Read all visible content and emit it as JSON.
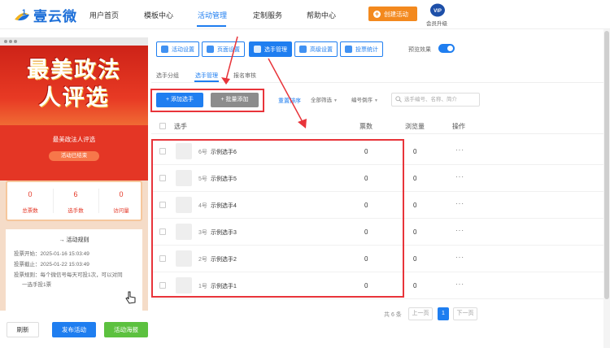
{
  "header": {
    "logo_text": "壹云微",
    "nav": [
      "用户首页",
      "模板中心",
      "活动管理",
      "定制服务",
      "帮助中心"
    ],
    "active_nav": "活动管理",
    "create_label": "创建活动",
    "vip_badge": "VIP",
    "vip_label": "会员升级"
  },
  "preview": {
    "hero_title_line1": "最美政法",
    "hero_title_line2": "人评选",
    "activity_title": "最美政法人评选",
    "status": "活动已结束",
    "stats": [
      {
        "value": "0",
        "label": "总票数"
      },
      {
        "value": "6",
        "label": "选手数"
      },
      {
        "value": "0",
        "label": "访问量"
      }
    ],
    "rules_title": "活动规则",
    "rules": [
      "投票开始：2025-01-16 15:03:49",
      "投票截止：2025-01-22 15:03:49",
      "投票规则：每个微信号每天可投1次，可以对同",
      "一选手投1票"
    ],
    "tabbar": [
      "介绍",
      "投票",
      "排行",
      "搜索"
    ]
  },
  "bottom_actions": {
    "refresh": "刷新",
    "publish": "发布活动",
    "poster": "活动海报"
  },
  "toolbar": {
    "buttons": [
      "活动设置",
      "页面设置",
      "选手管理",
      "高级设置",
      "投票统计"
    ],
    "active": "选手管理",
    "preview_label": "预览效果",
    "preview_on": true
  },
  "subtabs": [
    "选手分组",
    "选手管理",
    "报名审核"
  ],
  "active_subtab": "选手管理",
  "actions": {
    "add": "+ 添加选手",
    "batch": "+ 批量添加",
    "reset": "重置排序",
    "filter_all": "全部筛选",
    "filter_sort": "编号倒序",
    "search_placeholder": "选手编号、名称、简介"
  },
  "table": {
    "headers": [
      "选手",
      "票数",
      "浏览量",
      "操作"
    ],
    "rows": [
      {
        "no": "6号",
        "name": "示例选手6",
        "votes": "0",
        "views": "0",
        "op": "···"
      },
      {
        "no": "5号",
        "name": "示例选手5",
        "votes": "0",
        "views": "0",
        "op": "···"
      },
      {
        "no": "4号",
        "name": "示例选手4",
        "votes": "0",
        "views": "0",
        "op": "···"
      },
      {
        "no": "3号",
        "name": "示例选手3",
        "votes": "0",
        "views": "0",
        "op": "···"
      },
      {
        "no": "2号",
        "name": "示例选手2",
        "votes": "0",
        "views": "0",
        "op": "···"
      },
      {
        "no": "1号",
        "name": "示例选手1",
        "votes": "0",
        "views": "0",
        "op": "···"
      }
    ]
  },
  "pagination": {
    "total": "共 6 条",
    "prev": "上一页",
    "current": "1",
    "next": "下一页"
  },
  "colors": {
    "primary": "#1f7ef0",
    "orange": "#f3891e",
    "green": "#5cc13f",
    "highlight": "#e8343a",
    "hero_red": "#e43625"
  }
}
